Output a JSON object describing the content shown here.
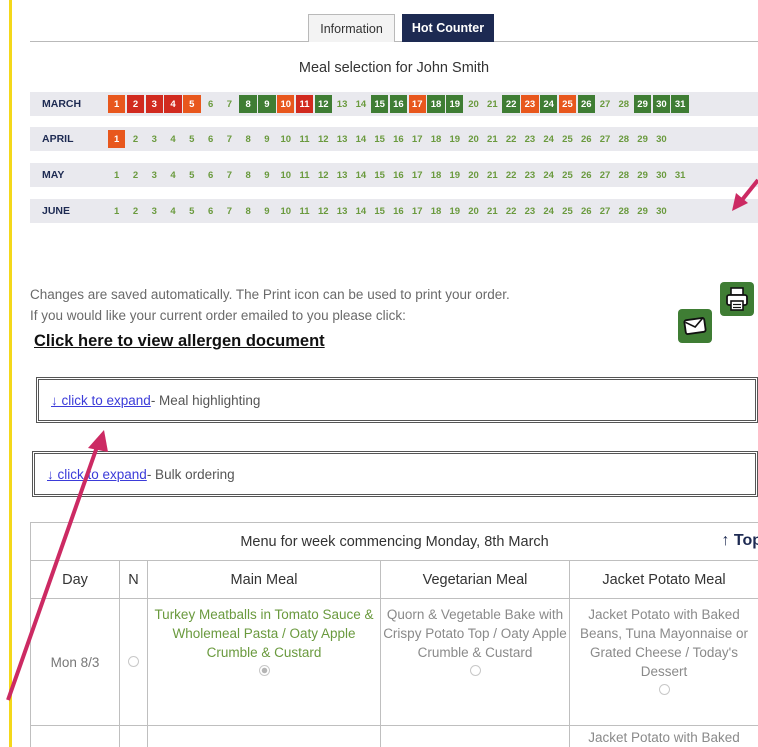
{
  "tabs": [
    {
      "label": "Information"
    },
    {
      "label": "Hot Counter"
    }
  ],
  "meal_selection_title": "Meal selection for John Smith",
  "calendar": [
    {
      "month": "MARCH",
      "days": [
        {
          "n": "1",
          "s": "orange"
        },
        {
          "n": "2",
          "s": "red"
        },
        {
          "n": "3",
          "s": "red"
        },
        {
          "n": "4",
          "s": "red"
        },
        {
          "n": "5",
          "s": "orange"
        },
        {
          "n": "6",
          "s": ""
        },
        {
          "n": "7",
          "s": ""
        },
        {
          "n": "8",
          "s": "green"
        },
        {
          "n": "9",
          "s": "green"
        },
        {
          "n": "10",
          "s": "orange"
        },
        {
          "n": "11",
          "s": "red"
        },
        {
          "n": "12",
          "s": "green"
        },
        {
          "n": "13",
          "s": ""
        },
        {
          "n": "14",
          "s": ""
        },
        {
          "n": "15",
          "s": "green"
        },
        {
          "n": "16",
          "s": "green"
        },
        {
          "n": "17",
          "s": "orange"
        },
        {
          "n": "18",
          "s": "green"
        },
        {
          "n": "19",
          "s": "green"
        },
        {
          "n": "20",
          "s": ""
        },
        {
          "n": "21",
          "s": ""
        },
        {
          "n": "22",
          "s": "green"
        },
        {
          "n": "23",
          "s": "orange"
        },
        {
          "n": "24",
          "s": "green"
        },
        {
          "n": "25",
          "s": "orange"
        },
        {
          "n": "26",
          "s": "green"
        },
        {
          "n": "27",
          "s": ""
        },
        {
          "n": "28",
          "s": ""
        },
        {
          "n": "29",
          "s": "green"
        },
        {
          "n": "30",
          "s": "green"
        },
        {
          "n": "31",
          "s": "green"
        }
      ]
    },
    {
      "month": "APRIL",
      "days": [
        {
          "n": "1",
          "s": "orange"
        },
        {
          "n": "2",
          "s": ""
        },
        {
          "n": "3",
          "s": ""
        },
        {
          "n": "4",
          "s": ""
        },
        {
          "n": "5",
          "s": ""
        },
        {
          "n": "6",
          "s": ""
        },
        {
          "n": "7",
          "s": ""
        },
        {
          "n": "8",
          "s": ""
        },
        {
          "n": "9",
          "s": ""
        },
        {
          "n": "10",
          "s": ""
        },
        {
          "n": "11",
          "s": ""
        },
        {
          "n": "12",
          "s": ""
        },
        {
          "n": "13",
          "s": ""
        },
        {
          "n": "14",
          "s": ""
        },
        {
          "n": "15",
          "s": ""
        },
        {
          "n": "16",
          "s": ""
        },
        {
          "n": "17",
          "s": ""
        },
        {
          "n": "18",
          "s": ""
        },
        {
          "n": "19",
          "s": ""
        },
        {
          "n": "20",
          "s": ""
        },
        {
          "n": "21",
          "s": ""
        },
        {
          "n": "22",
          "s": ""
        },
        {
          "n": "23",
          "s": ""
        },
        {
          "n": "24",
          "s": ""
        },
        {
          "n": "25",
          "s": ""
        },
        {
          "n": "26",
          "s": ""
        },
        {
          "n": "27",
          "s": ""
        },
        {
          "n": "28",
          "s": ""
        },
        {
          "n": "29",
          "s": ""
        },
        {
          "n": "30",
          "s": ""
        }
      ]
    },
    {
      "month": "MAY",
      "days": [
        {
          "n": "1",
          "s": ""
        },
        {
          "n": "2",
          "s": ""
        },
        {
          "n": "3",
          "s": ""
        },
        {
          "n": "4",
          "s": ""
        },
        {
          "n": "5",
          "s": ""
        },
        {
          "n": "6",
          "s": ""
        },
        {
          "n": "7",
          "s": ""
        },
        {
          "n": "8",
          "s": ""
        },
        {
          "n": "9",
          "s": ""
        },
        {
          "n": "10",
          "s": ""
        },
        {
          "n": "11",
          "s": ""
        },
        {
          "n": "12",
          "s": ""
        },
        {
          "n": "13",
          "s": ""
        },
        {
          "n": "14",
          "s": ""
        },
        {
          "n": "15",
          "s": ""
        },
        {
          "n": "16",
          "s": ""
        },
        {
          "n": "17",
          "s": ""
        },
        {
          "n": "18",
          "s": ""
        },
        {
          "n": "19",
          "s": ""
        },
        {
          "n": "20",
          "s": ""
        },
        {
          "n": "21",
          "s": ""
        },
        {
          "n": "22",
          "s": ""
        },
        {
          "n": "23",
          "s": ""
        },
        {
          "n": "24",
          "s": ""
        },
        {
          "n": "25",
          "s": ""
        },
        {
          "n": "26",
          "s": ""
        },
        {
          "n": "27",
          "s": ""
        },
        {
          "n": "28",
          "s": ""
        },
        {
          "n": "29",
          "s": ""
        },
        {
          "n": "30",
          "s": ""
        },
        {
          "n": "31",
          "s": ""
        }
      ]
    },
    {
      "month": "JUNE",
      "days": [
        {
          "n": "1",
          "s": ""
        },
        {
          "n": "2",
          "s": ""
        },
        {
          "n": "3",
          "s": ""
        },
        {
          "n": "4",
          "s": ""
        },
        {
          "n": "5",
          "s": ""
        },
        {
          "n": "6",
          "s": ""
        },
        {
          "n": "7",
          "s": ""
        },
        {
          "n": "8",
          "s": ""
        },
        {
          "n": "9",
          "s": ""
        },
        {
          "n": "10",
          "s": ""
        },
        {
          "n": "11",
          "s": ""
        },
        {
          "n": "12",
          "s": ""
        },
        {
          "n": "13",
          "s": ""
        },
        {
          "n": "14",
          "s": ""
        },
        {
          "n": "15",
          "s": ""
        },
        {
          "n": "16",
          "s": ""
        },
        {
          "n": "17",
          "s": ""
        },
        {
          "n": "18",
          "s": ""
        },
        {
          "n": "19",
          "s": ""
        },
        {
          "n": "20",
          "s": ""
        },
        {
          "n": "21",
          "s": ""
        },
        {
          "n": "22",
          "s": ""
        },
        {
          "n": "23",
          "s": ""
        },
        {
          "n": "24",
          "s": ""
        },
        {
          "n": "25",
          "s": ""
        },
        {
          "n": "26",
          "s": ""
        },
        {
          "n": "27",
          "s": ""
        },
        {
          "n": "28",
          "s": ""
        },
        {
          "n": "29",
          "s": ""
        },
        {
          "n": "30",
          "s": ""
        }
      ]
    }
  ],
  "info": {
    "line1": "Changes are saved automatically. The Print icon can be used to print your order.",
    "line2": "If you would like your current order emailed to you please click:",
    "allergen_link": "Click here to view allergen document"
  },
  "icons": {
    "print": "printer-icon",
    "email": "envelope-icon"
  },
  "expanders": {
    "expand_link": "↓ click to expand",
    "meal_highlighting": " - Meal highlighting",
    "bulk_ordering": " - Bulk ordering"
  },
  "menu": {
    "caption": "Menu for week commencing Monday, 8th March",
    "top_link": "↑ Top",
    "headers": [
      "Day",
      "N",
      "Main Meal",
      "Vegetarian Meal",
      "Jacket Potato Meal"
    ],
    "rows": [
      {
        "day": "Mon 8/3",
        "main": "Turkey Meatballs in Tomato Sauce & Wholemeal Pasta / Oaty Apple Crumble & Custard",
        "veg": "Quorn & Vegetable Bake with Crispy Potato Top / Oaty Apple Crumble & Custard",
        "jacket": "Jacket Potato with Baked Beans, Tuna Mayonnaise or Grated Cheese / Today's Dessert"
      },
      {
        "day": "",
        "main": "",
        "veg": "",
        "jacket": "Jacket Potato with Baked"
      }
    ]
  },
  "colors": {
    "selected_green": "#3f7d34",
    "partial_orange": "#e8571d",
    "missing_red": "#d12a1f",
    "available_text_green": "#6a9a3e",
    "navy": "#1d2a52",
    "annotation_arrow": "#cc2a63"
  }
}
